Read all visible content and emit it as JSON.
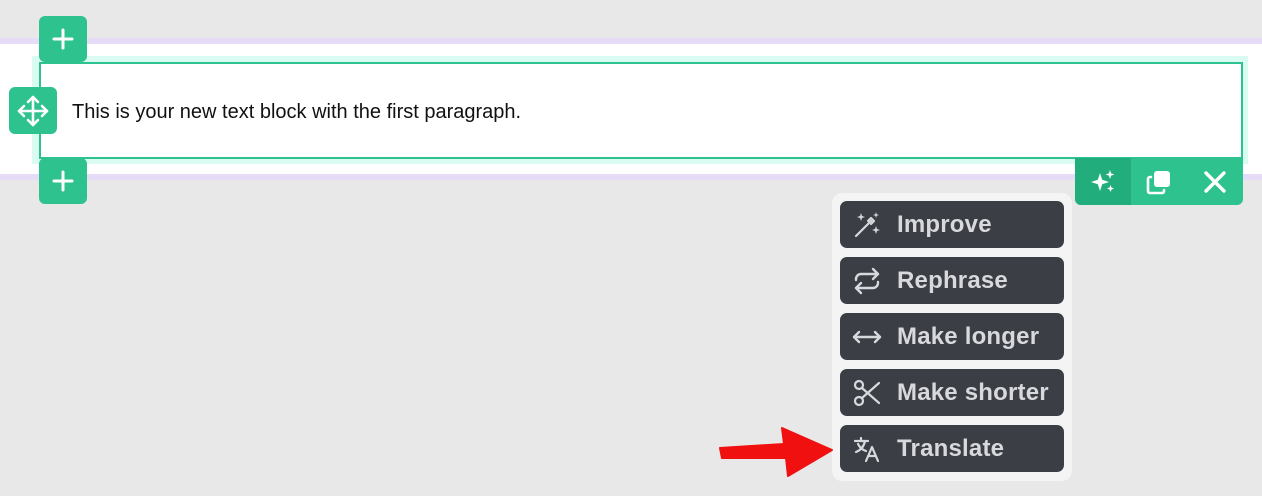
{
  "editor": {
    "paragraph_text": "This is your new text block with the first paragraph."
  },
  "ai_menu": {
    "items": [
      {
        "label": "Improve",
        "icon": "magic-wand-icon"
      },
      {
        "label": "Rephrase",
        "icon": "repeat-icon"
      },
      {
        "label": "Make longer",
        "icon": "arrows-horizontal-icon"
      },
      {
        "label": "Make shorter",
        "icon": "scissors-icon"
      },
      {
        "label": "Translate",
        "icon": "translate-icon"
      }
    ]
  },
  "toolbar": {
    "buttons": [
      "sparkles-icon",
      "duplicate-icon",
      "close-icon"
    ]
  },
  "colors": {
    "accent": "#2ec28f",
    "row_border": "#9b5de5",
    "menu_item_bg": "#3b3e45",
    "annotation_arrow": "#f01010"
  }
}
